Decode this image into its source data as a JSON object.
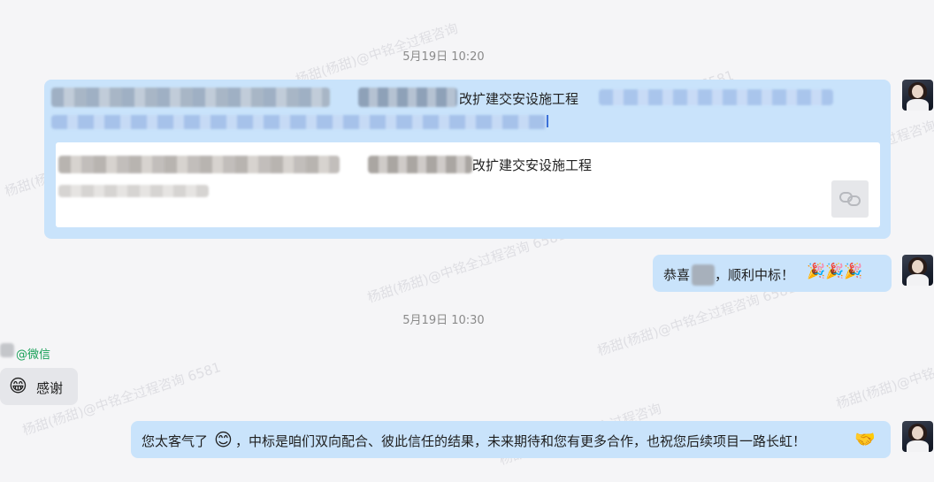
{
  "watermark": {
    "text_a": "杨甜(杨甜)@中铭全过程咨询 6581",
    "text_b": "杨甜(杨甜)@中铭全过程咨询"
  },
  "timestamps": [
    "5月19日 10:20",
    "5月19日 10:30"
  ],
  "messages": {
    "m1": {
      "visible_text": "改扩建交安设施工程",
      "link_card": {
        "title_visible": "改扩建交安设施工程",
        "link_icon": "link-chain-icon"
      }
    },
    "m2": {
      "text_prefix": "恭喜",
      "text_suffix": "，顺利中标！",
      "emojis": "🎉🎉🎉"
    },
    "m3": {
      "sender_suffix": "@微信",
      "emoji": "😁",
      "text": "感谢"
    },
    "m4": {
      "text_a": "您太客气了",
      "emoji_a": "😊",
      "text_b": "，中标是咱们双向配合、彼此信任的结果，未来期待和您有更多合作，也祝您后续项目一路长虹！",
      "emoji_b": "🤝"
    }
  },
  "colors": {
    "self_bubble": "#c9e3fb",
    "other_bubble": "#e5e6ea",
    "sender_green": "#18a058",
    "background": "#f5f5f7"
  }
}
